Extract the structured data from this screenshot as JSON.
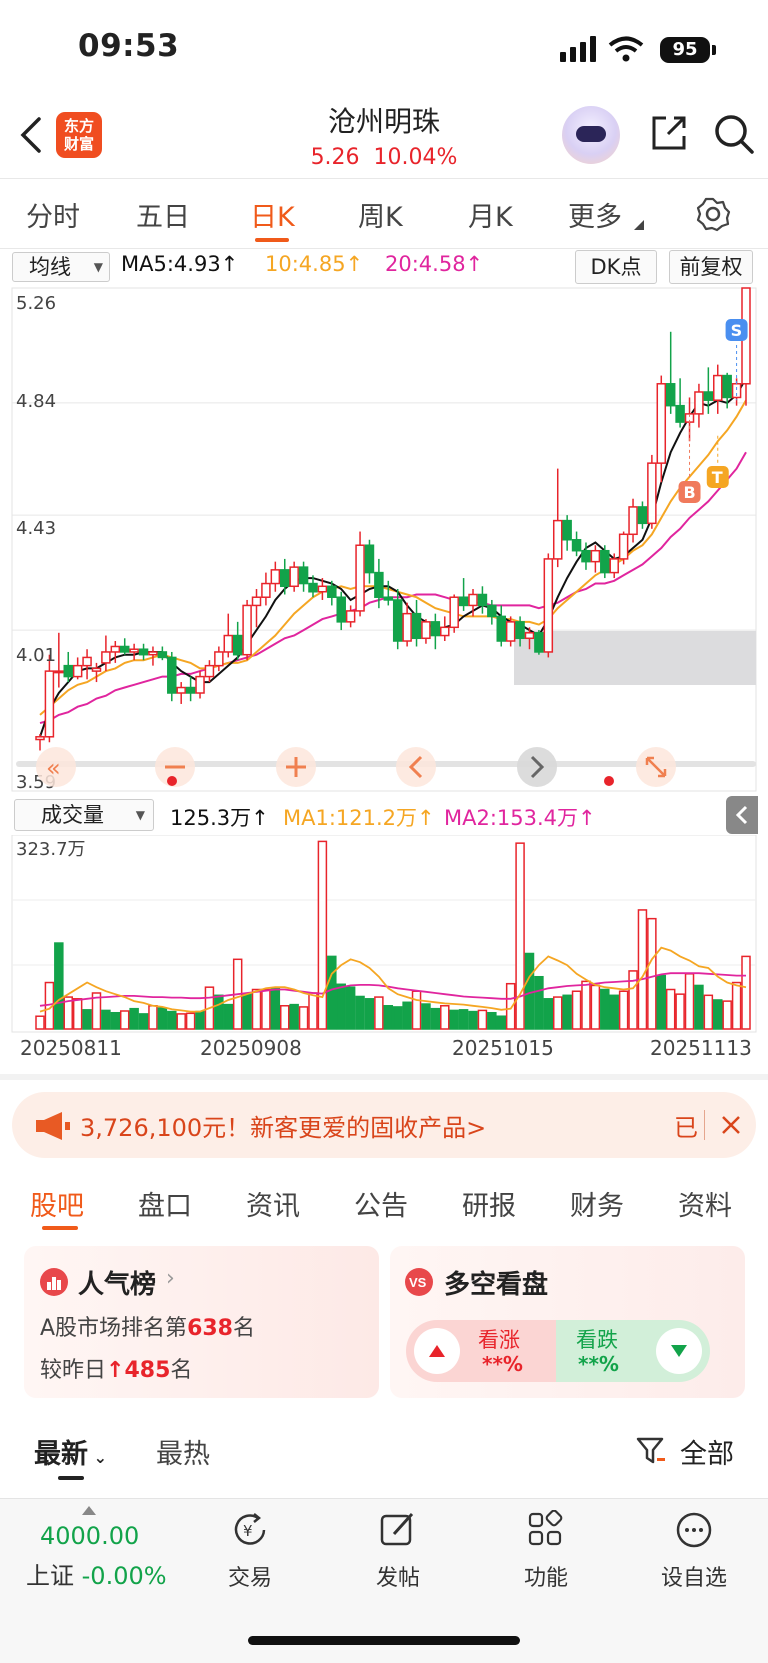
{
  "status_bar": {
    "time": "09:53",
    "battery": "95"
  },
  "header": {
    "logo_text": "东方财富",
    "stock_name": "沧州明珠",
    "price": "5.26",
    "change_pct": "10.04%"
  },
  "tabs": {
    "items": [
      "分时",
      "五日",
      "日K",
      "周K",
      "月K",
      "更多"
    ],
    "active": "日K"
  },
  "kline_header": {
    "indicator_select": "均线",
    "ma5": "MA5:4.93↑",
    "ma10": "10:4.85↑",
    "ma20": "20:4.58↑",
    "dk_button": "DK点",
    "adjust_button": "前复权"
  },
  "price_axis": [
    "5.26",
    "4.84",
    "4.43",
    "4.01",
    "3.59"
  ],
  "markers": {
    "s": "S",
    "b": "B",
    "t": "T"
  },
  "volume_header": {
    "indicator_select": "成交量",
    "volume": "125.3万↑",
    "ma1": "MA1:121.2万↑",
    "ma2": "MA2:153.4万↑",
    "max_label": "323.7万"
  },
  "date_axis": [
    "20250811",
    "20250908",
    "20251015",
    "20251113"
  ],
  "colors": {
    "up": "#e8242b",
    "down": "#12a34a",
    "ma5": "#111111",
    "ma10": "#f5a623",
    "ma20": "#e0259e",
    "accent": "#f05a1a"
  },
  "chart_data": {
    "type": "candlestick",
    "ylim": [
      3.59,
      5.26
    ],
    "candles": [
      [
        3.61,
        3.63,
        3.57,
        3.62
      ],
      [
        3.62,
        3.92,
        3.6,
        3.86
      ],
      [
        3.86,
        4.0,
        3.8,
        3.86
      ],
      [
        3.88,
        3.93,
        3.82,
        3.84
      ],
      [
        3.84,
        3.91,
        3.83,
        3.88
      ],
      [
        3.88,
        3.94,
        3.83,
        3.91
      ],
      [
        3.86,
        3.89,
        3.82,
        3.87
      ],
      [
        3.89,
        3.99,
        3.86,
        3.93
      ],
      [
        3.93,
        3.97,
        3.89,
        3.95
      ],
      [
        3.95,
        3.98,
        3.92,
        3.93
      ],
      [
        3.93,
        3.96,
        3.9,
        3.94
      ],
      [
        3.94,
        3.96,
        3.9,
        3.92
      ],
      [
        3.92,
        3.95,
        3.88,
        3.93
      ],
      [
        3.93,
        3.95,
        3.9,
        3.91
      ],
      [
        3.91,
        3.93,
        3.75,
        3.78
      ],
      [
        3.78,
        3.82,
        3.74,
        3.8
      ],
      [
        3.8,
        3.84,
        3.75,
        3.78
      ],
      [
        3.78,
        3.86,
        3.76,
        3.84
      ],
      [
        3.84,
        3.9,
        3.82,
        3.88
      ],
      [
        3.88,
        3.95,
        3.86,
        3.93
      ],
      [
        3.93,
        4.07,
        3.91,
        3.99
      ],
      [
        3.99,
        4.04,
        3.9,
        3.92
      ],
      [
        3.92,
        4.12,
        3.9,
        4.1
      ],
      [
        4.1,
        4.16,
        4.02,
        4.13
      ],
      [
        4.13,
        4.22,
        4.1,
        4.18
      ],
      [
        4.18,
        4.26,
        4.15,
        4.23
      ],
      [
        4.23,
        4.27,
        4.14,
        4.17
      ],
      [
        4.17,
        4.26,
        4.15,
        4.24
      ],
      [
        4.24,
        4.26,
        4.15,
        4.18
      ],
      [
        4.18,
        4.21,
        4.13,
        4.15
      ],
      [
        4.15,
        4.2,
        4.12,
        4.17
      ],
      [
        4.17,
        4.19,
        4.1,
        4.13
      ],
      [
        4.13,
        4.15,
        4.01,
        4.04
      ],
      [
        4.04,
        4.1,
        4.02,
        4.08
      ],
      [
        4.08,
        4.37,
        4.06,
        4.32
      ],
      [
        4.32,
        4.34,
        4.18,
        4.22
      ],
      [
        4.22,
        4.27,
        4.09,
        4.13
      ],
      [
        4.13,
        4.19,
        4.1,
        4.12
      ],
      [
        4.12,
        4.16,
        3.94,
        3.97
      ],
      [
        3.97,
        4.11,
        3.95,
        4.07
      ],
      [
        4.07,
        4.12,
        3.95,
        3.98
      ],
      [
        3.98,
        4.05,
        3.96,
        4.04
      ],
      [
        4.04,
        4.07,
        3.94,
        3.99
      ],
      [
        3.99,
        4.06,
        3.97,
        4.02
      ],
      [
        4.02,
        4.14,
        4.0,
        4.13
      ],
      [
        4.13,
        4.2,
        4.08,
        4.1
      ],
      [
        4.1,
        4.16,
        4.06,
        4.14
      ],
      [
        4.14,
        4.17,
        4.07,
        4.1
      ],
      [
        4.1,
        4.12,
        4.03,
        4.06
      ],
      [
        4.06,
        4.1,
        3.95,
        3.97
      ],
      [
        3.97,
        4.06,
        3.95,
        4.04
      ],
      [
        4.04,
        4.06,
        3.95,
        3.98
      ],
      [
        3.98,
        4.02,
        3.94,
        4.0
      ],
      [
        4.0,
        4.01,
        3.92,
        3.93
      ],
      [
        3.93,
        4.29,
        3.91,
        4.27
      ],
      [
        4.27,
        4.6,
        4.24,
        4.41
      ],
      [
        4.41,
        4.43,
        4.3,
        4.34
      ],
      [
        4.34,
        4.37,
        4.28,
        4.3
      ],
      [
        4.3,
        4.33,
        4.23,
        4.26
      ],
      [
        4.26,
        4.32,
        4.22,
        4.3
      ],
      [
        4.3,
        4.32,
        4.2,
        4.22
      ],
      [
        4.22,
        4.29,
        4.2,
        4.27
      ],
      [
        4.27,
        4.37,
        4.25,
        4.36
      ],
      [
        4.36,
        4.49,
        4.33,
        4.46
      ],
      [
        4.46,
        4.48,
        4.38,
        4.4
      ],
      [
        4.4,
        4.65,
        4.38,
        4.62
      ],
      [
        4.62,
        4.94,
        4.55,
        4.91
      ],
      [
        4.91,
        5.1,
        4.8,
        4.83
      ],
      [
        4.83,
        4.93,
        4.75,
        4.77
      ],
      [
        4.77,
        4.86,
        4.7,
        4.8
      ],
      [
        4.8,
        4.91,
        4.75,
        4.88
      ],
      [
        4.88,
        4.97,
        4.8,
        4.85
      ],
      [
        4.85,
        4.98,
        4.8,
        4.94
      ],
      [
        4.94,
        4.95,
        4.82,
        4.86
      ],
      [
        4.86,
        4.93,
        4.83,
        4.91
      ],
      [
        4.91,
        5.1,
        4.83,
        5.26
      ]
    ],
    "volume": [
      [
        22,
        1
      ],
      [
        80,
        1
      ],
      [
        148,
        0
      ],
      [
        55,
        1
      ],
      [
        52,
        1
      ],
      [
        33,
        0
      ],
      [
        62,
        1
      ],
      [
        32,
        0
      ],
      [
        28,
        0
      ],
      [
        31,
        1
      ],
      [
        35,
        0
      ],
      [
        26,
        0
      ],
      [
        40,
        1
      ],
      [
        36,
        0
      ],
      [
        30,
        0
      ],
      [
        26,
        1
      ],
      [
        27,
        1
      ],
      [
        30,
        0
      ],
      [
        72,
        1
      ],
      [
        58,
        0
      ],
      [
        42,
        0
      ],
      [
        120,
        1
      ],
      [
        60,
        0
      ],
      [
        68,
        1
      ],
      [
        68,
        1
      ],
      [
        70,
        0
      ],
      [
        40,
        1
      ],
      [
        42,
        0
      ],
      [
        38,
        1
      ],
      [
        62,
        1
      ],
      [
        323,
        1
      ],
      [
        125,
        0
      ],
      [
        77,
        0
      ],
      [
        72,
        0
      ],
      [
        56,
        0
      ],
      [
        52,
        0
      ],
      [
        55,
        1
      ],
      [
        40,
        0
      ],
      [
        38,
        0
      ],
      [
        46,
        0
      ],
      [
        65,
        1
      ],
      [
        43,
        0
      ],
      [
        35,
        0
      ],
      [
        40,
        1
      ],
      [
        32,
        0
      ],
      [
        33,
        0
      ],
      [
        30,
        0
      ],
      [
        32,
        1
      ],
      [
        28,
        0
      ],
      [
        22,
        0
      ],
      [
        78,
        1
      ],
      [
        320,
        1
      ],
      [
        130,
        0
      ],
      [
        90,
        0
      ],
      [
        52,
        0
      ],
      [
        55,
        1
      ],
      [
        58,
        0
      ],
      [
        65,
        1
      ],
      [
        82,
        1
      ],
      [
        75,
        1
      ],
      [
        68,
        0
      ],
      [
        58,
        0
      ],
      [
        65,
        1
      ],
      [
        100,
        1
      ],
      [
        205,
        1
      ],
      [
        190,
        1
      ],
      [
        92,
        0
      ],
      [
        68,
        1
      ],
      [
        60,
        1
      ],
      [
        95,
        1
      ],
      [
        75,
        0
      ],
      [
        58,
        1
      ],
      [
        50,
        0
      ],
      [
        48,
        1
      ],
      [
        80,
        1
      ],
      [
        125,
        1
      ]
    ],
    "ma5": [
      3.62,
      3.72,
      3.78,
      3.82,
      3.86,
      3.87,
      3.87,
      3.89,
      3.91,
      3.92,
      3.92,
      3.93,
      3.93,
      3.93,
      3.89,
      3.86,
      3.84,
      3.82,
      3.82,
      3.85,
      3.88,
      3.91,
      3.96,
      4.01,
      4.06,
      4.12,
      4.16,
      4.19,
      4.2,
      4.2,
      4.19,
      4.18,
      4.16,
      4.12,
      4.14,
      4.16,
      4.17,
      4.17,
      4.15,
      4.1,
      4.06,
      4.04,
      4.01,
      4.02,
      4.03,
      4.06,
      4.08,
      4.1,
      4.09,
      4.06,
      4.04,
      4.03,
      4.01,
      3.99,
      4.05,
      4.13,
      4.2,
      4.26,
      4.31,
      4.33,
      4.3,
      4.27,
      4.28,
      4.31,
      4.34,
      4.42,
      4.55,
      4.66,
      4.73,
      4.79,
      4.84,
      4.83,
      4.85,
      4.84,
      4.87,
      4.93
    ],
    "ma10": [
      3.7,
      3.73,
      3.76,
      3.79,
      3.81,
      3.82,
      3.84,
      3.86,
      3.87,
      3.89,
      3.9,
      3.9,
      3.91,
      3.92,
      3.91,
      3.9,
      3.89,
      3.87,
      3.87,
      3.88,
      3.89,
      3.89,
      3.9,
      3.93,
      3.96,
      3.99,
      4.03,
      4.07,
      4.1,
      4.13,
      4.15,
      4.16,
      4.17,
      4.16,
      4.17,
      4.17,
      4.17,
      4.16,
      4.15,
      4.14,
      4.13,
      4.11,
      4.09,
      4.08,
      4.07,
      4.06,
      4.06,
      4.06,
      4.06,
      4.05,
      4.05,
      4.04,
      4.04,
      4.03,
      4.05,
      4.09,
      4.12,
      4.15,
      4.18,
      4.21,
      4.23,
      4.25,
      4.27,
      4.3,
      4.32,
      4.36,
      4.42,
      4.48,
      4.53,
      4.57,
      4.61,
      4.65,
      4.7,
      4.74,
      4.79,
      4.85
    ],
    "ma20": [
      3.67,
      3.68,
      3.7,
      3.71,
      3.73,
      3.74,
      3.76,
      3.77,
      3.79,
      3.8,
      3.81,
      3.82,
      3.83,
      3.84,
      3.84,
      3.85,
      3.85,
      3.86,
      3.87,
      3.88,
      3.89,
      3.9,
      3.91,
      3.92,
      3.94,
      3.96,
      3.98,
      3.99,
      4.01,
      4.03,
      4.05,
      4.06,
      4.07,
      4.08,
      4.09,
      4.11,
      4.12,
      4.13,
      4.13,
      4.13,
      4.14,
      4.14,
      4.14,
      4.13,
      4.12,
      4.12,
      4.11,
      4.11,
      4.1,
      4.1,
      4.1,
      4.1,
      4.1,
      4.09,
      4.1,
      4.11,
      4.13,
      4.15,
      4.16,
      4.18,
      4.18,
      4.19,
      4.21,
      4.23,
      4.25,
      4.28,
      4.31,
      4.35,
      4.38,
      4.42,
      4.45,
      4.48,
      4.52,
      4.56,
      4.6,
      4.66
    ],
    "vol_ma1": [
      30,
      35,
      50,
      60,
      70,
      80,
      72,
      65,
      60,
      55,
      48,
      45,
      40,
      38,
      34,
      32,
      30,
      30,
      36,
      42,
      50,
      55,
      60,
      65,
      70,
      72,
      72,
      68,
      62,
      58,
      55,
      95,
      110,
      120,
      115,
      105,
      90,
      70,
      60,
      55,
      50,
      48,
      46,
      44,
      43,
      42,
      40,
      38,
      36,
      33,
      35,
      60,
      90,
      110,
      125,
      118,
      110,
      95,
      85,
      76,
      72,
      70,
      68,
      70,
      90,
      120,
      140,
      135,
      125,
      118,
      108,
      105,
      90,
      80,
      75,
      72
    ],
    "vol_ma2": [
      40,
      42,
      45,
      48,
      50,
      52,
      54,
      55,
      56,
      57,
      57,
      56,
      55,
      55,
      54,
      54,
      53,
      53,
      54,
      56,
      58,
      60,
      62,
      64,
      66,
      68,
      68,
      66,
      64,
      62,
      61,
      68,
      72,
      75,
      76,
      76,
      75,
      73,
      70,
      68,
      66,
      64,
      62,
      60,
      58,
      56,
      55,
      54,
      53,
      52,
      52,
      56,
      62,
      66,
      70,
      72,
      74,
      75,
      76,
      78,
      80,
      81,
      82,
      83,
      86,
      90,
      94,
      96,
      96,
      96,
      96,
      95,
      94,
      93,
      92,
      92
    ]
  },
  "toolbar_icons": [
    "rewind-icon",
    "minus-icon",
    "plus-icon",
    "left-arrow-icon",
    "right-arrow-icon",
    "expand-icon"
  ],
  "ad": {
    "text": "3,726,100元！新客更爱的固收产品>",
    "right_text": "已"
  },
  "community_tabs": {
    "items": [
      "股吧",
      "盘口",
      "资讯",
      "公告",
      "研报",
      "财务",
      "资料"
    ],
    "active": "股吧"
  },
  "popularity_card": {
    "title": "人气榜",
    "rank_prefix": "A股市场排名第",
    "rank": "638",
    "rank_suffix": "名",
    "change_prefix": "较昨日",
    "change": "485",
    "change_suffix": "名"
  },
  "sentiment_card": {
    "title": "多空看盘",
    "bull_label": "看涨",
    "bull_value": "**%",
    "bear_label": "看跌",
    "bear_value": "**%"
  },
  "feed_tabs": {
    "latest": "最新",
    "hot": "最热",
    "filter": "全部"
  },
  "bottom_bar": {
    "index_value": "4000.00",
    "index_name": "上证",
    "index_change": "-0.00%",
    "items": [
      "交易",
      "发帖",
      "功能",
      "设自选"
    ]
  }
}
